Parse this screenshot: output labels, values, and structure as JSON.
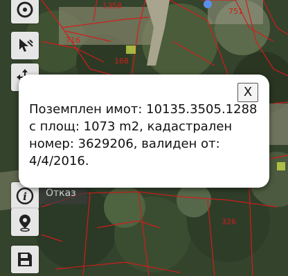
{
  "map": {
    "parcel_labels": [
      "1358",
      "751",
      "716",
      "168",
      "326"
    ]
  },
  "dialog": {
    "close_label": "X",
    "message": "Поземплен имот: 10135.3505.1288 с площ: 1073 m2, кадастрален номер: 3629206, валиден от: 4/4/2016."
  },
  "toolbar": {
    "cancel_label": "Отказ",
    "icons": [
      "compass-icon",
      "select-cursor-icon",
      "move-icon",
      "info-icon",
      "location-pin-icon",
      "save-icon"
    ]
  },
  "colors": {
    "parcel_line": "#d21c1c",
    "toolbar_bg": "#e6e6e6",
    "dialog_bg": "#ffffff"
  }
}
